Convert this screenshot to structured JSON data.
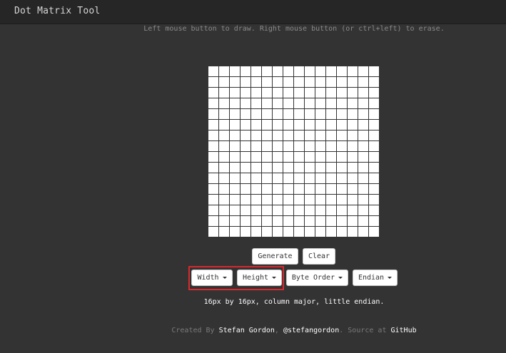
{
  "app": {
    "title": "Dot Matrix Tool"
  },
  "hint": "Left mouse button to draw. Right mouse button (or ctrl+left) to erase.",
  "grid": {
    "columns": 16,
    "rows": 16
  },
  "actions": {
    "generate": "Generate",
    "clear": "Clear"
  },
  "dropdowns": {
    "width": "Width",
    "height": "Height",
    "byte_order": "Byte Order",
    "endian": "Endian"
  },
  "summary": "16px by 16px, column major, little endian.",
  "footer": {
    "created_by": "Created By",
    "author": "Stefan Gordon",
    "sep": ",",
    "handle": "@stefangordon",
    "source_at": ". Source at",
    "github": "GitHub"
  },
  "colors": {
    "background": "#333333",
    "navbar": "#262626",
    "highlight": "#d9282e"
  }
}
